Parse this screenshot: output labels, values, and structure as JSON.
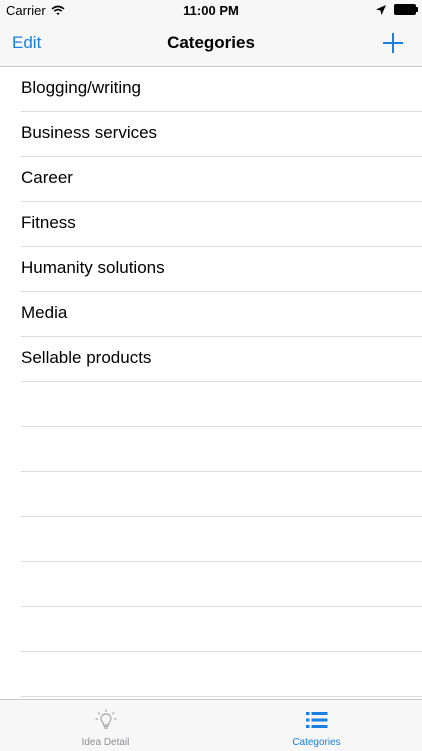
{
  "status_bar": {
    "carrier": "Carrier",
    "time": "11:00 PM"
  },
  "nav": {
    "edit_label": "Edit",
    "title": "Categories"
  },
  "categories": [
    "Blogging/writing",
    "Business services",
    "Career",
    "Fitness",
    "Humanity solutions",
    "Media",
    "Sellable products"
  ],
  "tabs": [
    {
      "label": "Idea Detail",
      "icon": "lightbulb-icon",
      "active": false
    },
    {
      "label": "Categories",
      "icon": "list-icon",
      "active": true
    }
  ],
  "colors": {
    "accent": "#1a7fe0",
    "inactive": "#8e8e93"
  }
}
